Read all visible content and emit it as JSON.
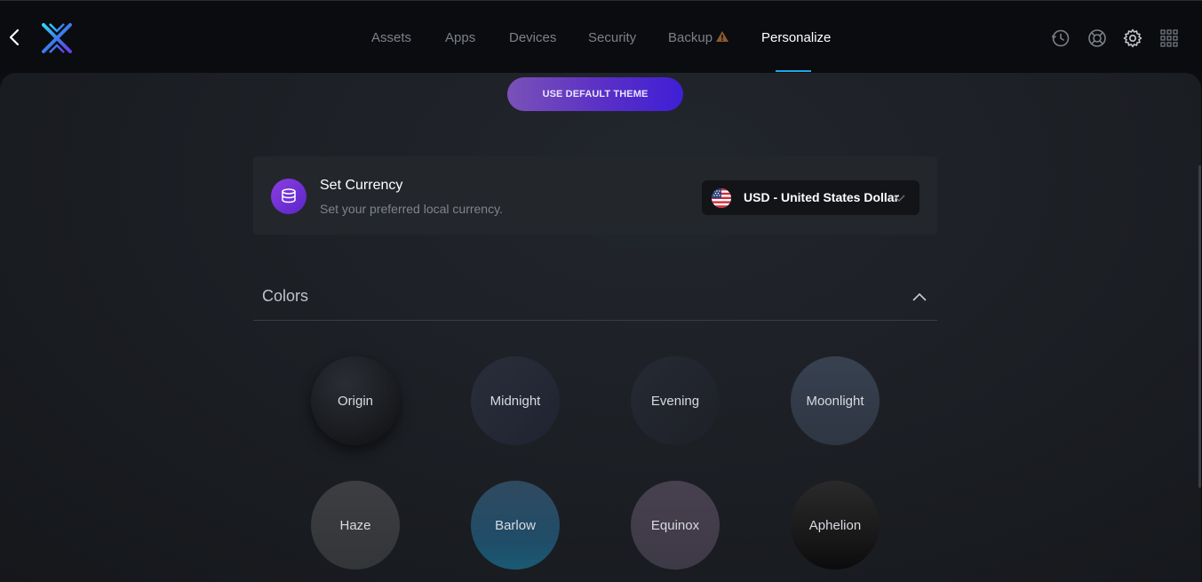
{
  "nav": {
    "items": [
      {
        "label": "Assets"
      },
      {
        "label": "Apps"
      },
      {
        "label": "Devices"
      },
      {
        "label": "Security"
      },
      {
        "label": "Backup"
      },
      {
        "label": "Personalize"
      }
    ],
    "active": "Personalize"
  },
  "top_icons": [
    "history-icon",
    "help-lifebuoy-icon",
    "settings-gear-icon",
    "apps-grid-icon"
  ],
  "theme_button": {
    "label": "USE DEFAULT THEME"
  },
  "currency": {
    "title": "Set Currency",
    "subtitle": "Set your preferred local currency.",
    "selected": "USD - United States Dollar"
  },
  "colors": {
    "title": "Colors",
    "swatches": [
      {
        "label": "Origin",
        "color": "#1e2126"
      },
      {
        "label": "Midnight",
        "color": "#262a35"
      },
      {
        "label": "Evening",
        "color": "#22252d"
      },
      {
        "label": "Moonlight",
        "color": "#333b49"
      },
      {
        "label": "Haze",
        "color": "#3a3b3e"
      },
      {
        "label": "Barlow",
        "color": "#2d4e66"
      },
      {
        "label": "Equinox",
        "color": "#433e4c"
      },
      {
        "label": "Aphelion",
        "color": "#1d1d1e"
      }
    ]
  },
  "accent_color": "#1aa7e8"
}
